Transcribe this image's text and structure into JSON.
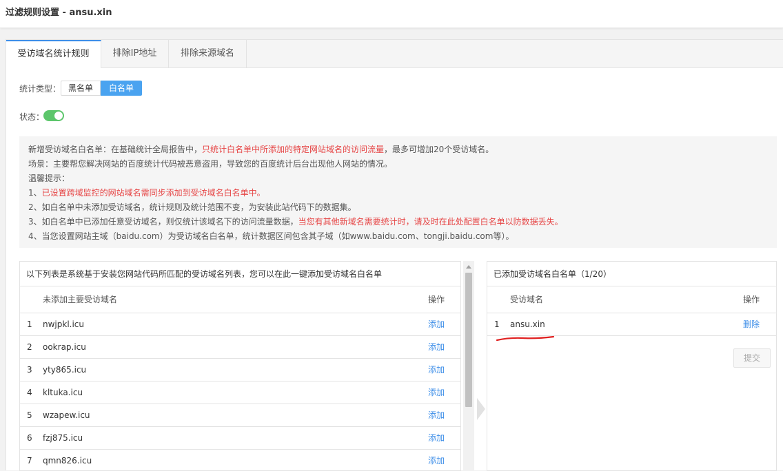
{
  "window": {
    "title": "过滤规则设置 - ansu.xin"
  },
  "tabs": [
    {
      "label": "受访域名统计规则",
      "active": true
    },
    {
      "label": "排除IP地址",
      "active": false
    },
    {
      "label": "排除来源域名",
      "active": false
    }
  ],
  "stat_type": {
    "label": "统计类型：",
    "options": [
      "黑名单",
      "白名单"
    ],
    "selected": "白名单"
  },
  "status": {
    "label": "状态：",
    "enabled": true
  },
  "notice": {
    "line1_a": "新增受访域名白名单：在基础统计全局报告中，",
    "line1_b": "只统计白名单中所添加的特定网站域名的访问流量",
    "line1_c": "，最多可增加20个受访域名。",
    "line2": "场景：主要帮您解决网站的百度统计代码被恶意盗用，导致您的百度统计后台出现他人网站的情况。",
    "line3": "温馨提示：",
    "line4_a": "1、",
    "line4_b": "已设置跨域监控的网站域名需同步添加到受访域名白名单中。",
    "line5": "2、如白名单中未添加受访域名，统计规则及统计范围不变，为安装此站代码下的数据集。",
    "line6_a": "3、如白名单中已添加任意受访域名，则仅统计该域名下的访问流量数据，",
    "line6_b": "当您有其他新域名需要统计时，请及时在此处配置白名单以防数据丢失。",
    "line7": "4、当您设置网站主域（baidu.com）为受访域名白名单，统计数据区间包含其子域（如www.baidu.com、tongji.baidu.com等）。"
  },
  "left_panel": {
    "header": "以下列表是系统基于安装您网站代码所匹配的受访域名列表，您可以在此一键添加受访域名白名单",
    "col_domain": "未添加主要受访域名",
    "col_action": "操作",
    "rows": [
      {
        "idx": "1",
        "domain": "nwjpkl.icu",
        "action": "添加"
      },
      {
        "idx": "2",
        "domain": "ookrap.icu",
        "action": "添加"
      },
      {
        "idx": "3",
        "domain": "yty865.icu",
        "action": "添加"
      },
      {
        "idx": "4",
        "domain": "kltuka.icu",
        "action": "添加"
      },
      {
        "idx": "5",
        "domain": "wzapew.icu",
        "action": "添加"
      },
      {
        "idx": "6",
        "domain": "fzj875.icu",
        "action": "添加"
      },
      {
        "idx": "7",
        "domain": "qmn826.icu",
        "action": "添加"
      }
    ]
  },
  "right_panel": {
    "header": "已添加受访域名白名单（1/20）",
    "col_domain": "受访域名",
    "col_action": "操作",
    "rows": [
      {
        "idx": "1",
        "domain": "ansu.xin",
        "action": "删除"
      }
    ],
    "submit_label": "提交"
  },
  "colors": {
    "accent": "#3d8ee8",
    "toggle_on": "#5cc66b",
    "warning_text": "#e64545",
    "annotation_stroke": "#e02020"
  }
}
